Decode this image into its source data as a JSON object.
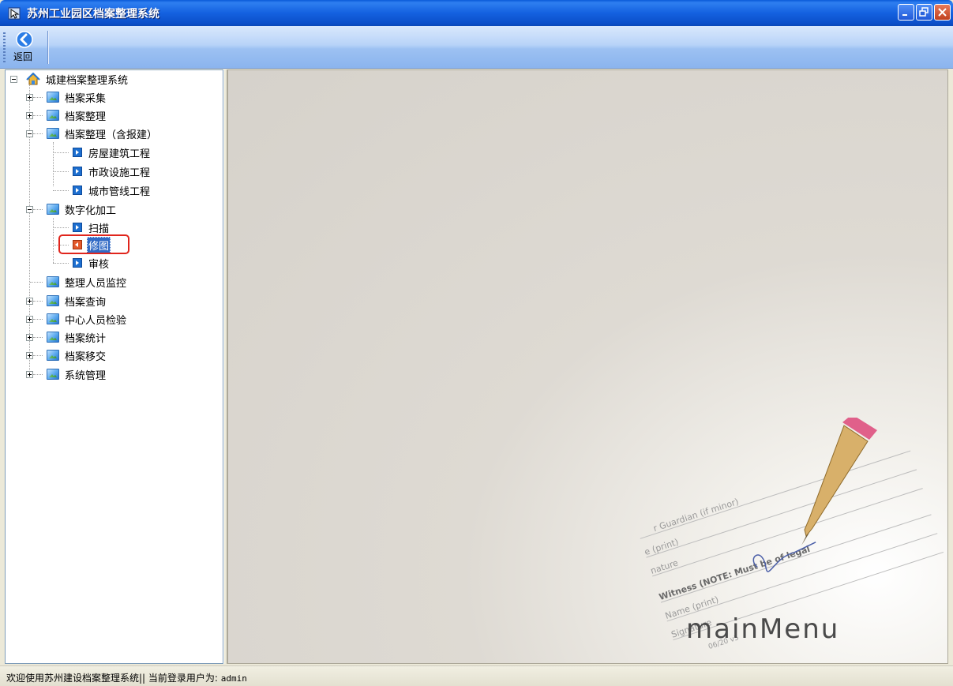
{
  "window": {
    "title": "苏州工业园区档案整理系统"
  },
  "toolbar": {
    "back_label": "返回"
  },
  "tree": {
    "root": "城建档案整理系统",
    "items": [
      {
        "label": "档案采集"
      },
      {
        "label": "档案整理"
      },
      {
        "label": "档案整理（含报建）",
        "children": [
          {
            "label": "房屋建筑工程"
          },
          {
            "label": "市政设施工程"
          },
          {
            "label": "城市管线工程"
          }
        ]
      },
      {
        "label": "数字化加工",
        "children": [
          {
            "label": "扫描"
          },
          {
            "label": "修图"
          },
          {
            "label": "审核"
          }
        ]
      },
      {
        "label": "整理人员监控"
      },
      {
        "label": "档案查询"
      },
      {
        "label": "中心人员检验"
      },
      {
        "label": "档案统计"
      },
      {
        "label": "档案移交"
      },
      {
        "label": "系统管理"
      }
    ],
    "selected": "修图"
  },
  "main": {
    "watermark": "mainMenu",
    "document_lines": [
      "r Guardian (if minor)",
      "e (print)",
      "nature",
      "Witness (NOTE: Must be of legal",
      "Name (print)",
      "Signature",
      "06/20 v5"
    ]
  },
  "status": {
    "text": "欢迎使用苏州建设档案整理系统|| 当前登录用户为: ",
    "user": "admin"
  },
  "colors": {
    "title_bar": "#0b4fc9",
    "selection": "#316ac5",
    "highlight_border": "#e0251c"
  }
}
